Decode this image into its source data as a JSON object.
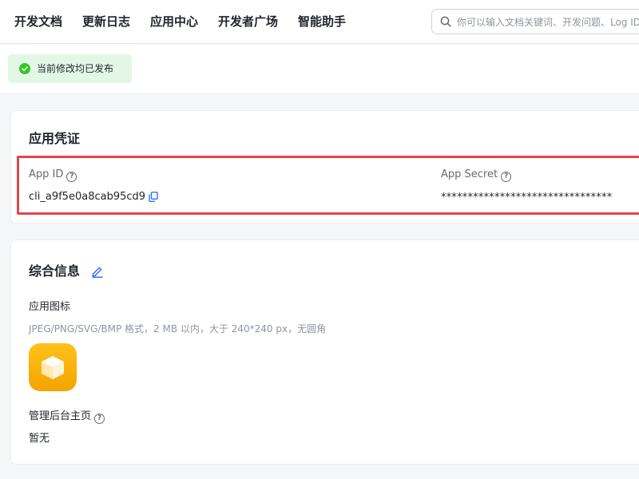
{
  "nav": {
    "items": [
      "开发文档",
      "更新日志",
      "应用中心",
      "开发者广场",
      "智能助手"
    ],
    "search_placeholder": "你可以输入文档关键词、开发问题、Log ID"
  },
  "status": {
    "text": "当前修改均已发布",
    "color": "#34c724"
  },
  "credentials": {
    "title": "应用凭证",
    "app_id_label": "App ID",
    "app_id_value": "cli_a9f5e0a8cab95cd9",
    "app_secret_label": "App Secret",
    "app_secret_value": "********************************",
    "highlight_color": "#e0474b"
  },
  "info": {
    "title": "综合信息",
    "icon_label": "应用图标",
    "icon_hint": "JPEG/PNG/SVG/BMP 格式，2 MB 以内，大于 240*240 px，无圆角",
    "admin_label": "管理后台主页",
    "admin_value": "暂无"
  },
  "icons": {
    "search": "search-icon",
    "help": "help-circle-icon",
    "copy": "copy-icon",
    "edit": "edit-pencil-icon",
    "check": "check-circle-icon",
    "app": "cube-icon"
  },
  "colors": {
    "accent": "#3370ff",
    "app_icon": "#ffb400"
  }
}
